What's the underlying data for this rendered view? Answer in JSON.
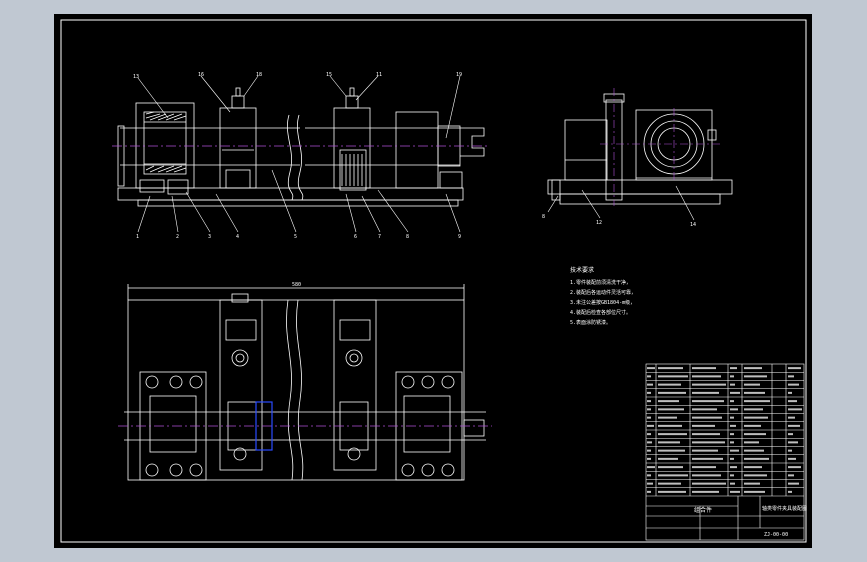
{
  "window": {
    "background": "#c0c8d2",
    "sheet_color": "#000000",
    "line_color": "#ffffff",
    "center_line_color": "#b050d8",
    "highlight_color": "#2a4bff"
  },
  "drawing": {
    "type": "mechanical assembly drawing",
    "views": [
      "front-view",
      "side-view",
      "top-view"
    ],
    "callouts_front": [
      "13",
      "16",
      "18",
      "15",
      "11",
      "19"
    ],
    "callouts_bottom": [
      "1",
      "2",
      "3",
      "4",
      "5",
      "6",
      "7",
      "8",
      "9"
    ],
    "side_callouts": [
      "8",
      "12",
      "14"
    ],
    "top_dimension": "580"
  },
  "notes": {
    "title": "技术要求",
    "lines": [
      "1.零件装配前须清洗干净，",
      "2.装配后各运动件灵活可靠，",
      "3.未注公差按GB1804-m级，",
      "4.装配后检查各部位尺寸。",
      "5.表面涂防锈漆。"
    ]
  },
  "title_block": {
    "part_name": "组合件",
    "drawing_title": "轴类零件夹具装配图",
    "drawing_number": "ZJ-00-00"
  }
}
